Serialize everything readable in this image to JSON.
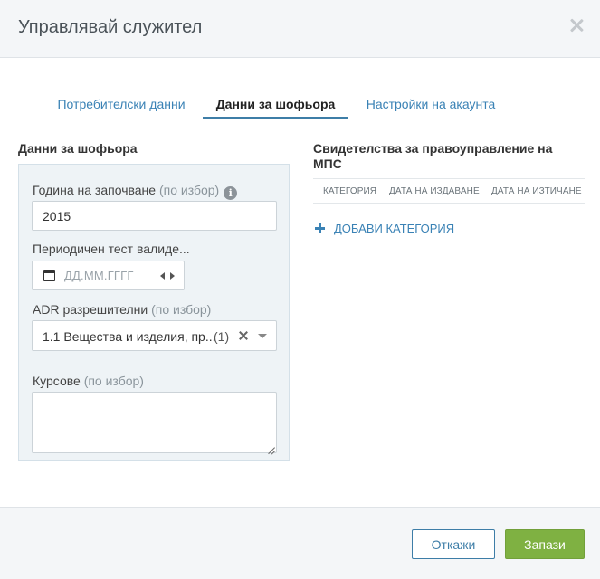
{
  "modal": {
    "title": "Управлявай служител"
  },
  "tabs": [
    {
      "label": "Потребителски данни",
      "active": false
    },
    {
      "label": "Данни за шофьора",
      "active": true
    },
    {
      "label": "Настройки на акаунта",
      "active": false
    }
  ],
  "driver": {
    "section_title": "Данни за шофьора",
    "start_year": {
      "label": "Година на започване",
      "optional": "(по избор)",
      "value": "2015",
      "icon": "info-icon"
    },
    "periodic_test": {
      "label": "Периодичен тест валиде...",
      "placeholder": "ДД.ММ.ГГГГ",
      "icon": "calendar-icon"
    },
    "adr": {
      "label": "ADR разрешителни",
      "optional": "(по избор)",
      "value": "1.1 Вещества и изделия, пр...",
      "count": "(1)"
    },
    "courses": {
      "label": "Курсове",
      "optional": "(по избор)",
      "value": ""
    }
  },
  "licences": {
    "section_title": "Свидетелства за правоуправление на МПС",
    "columns": [
      "КАТЕГОРИЯ",
      "ДАТА НА ИЗДАВАНЕ",
      "ДАТА НА ИЗТИЧАНЕ"
    ],
    "add_label": "ДОБАВИ КАТЕГОРИЯ"
  },
  "footer": {
    "cancel_label": "Откажи",
    "save_label": "Запази"
  },
  "colors": {
    "accent": "#3a82b5",
    "tab_underline": "#3e7ea7",
    "save_button": "#7fb142",
    "panel_background": "#eef3f6",
    "header_background": "#f4f6f8"
  }
}
